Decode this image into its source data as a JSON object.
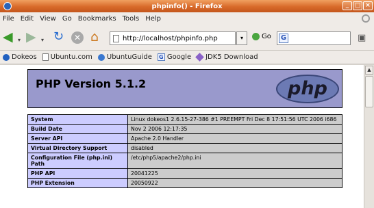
{
  "window": {
    "title": "phpinfo() - Firefox"
  },
  "menu": [
    "File",
    "Edit",
    "View",
    "Go",
    "Bookmarks",
    "Tools",
    "Help"
  ],
  "toolbar": {
    "url": "http://localhost/phpinfo.php",
    "go_label": "Go",
    "search_value": ""
  },
  "bookmarks": [
    "Dokeos",
    "Ubuntu.com",
    "UbuntuGuide",
    "Google",
    "JDK5 Download"
  ],
  "page": {
    "heading": "PHP Version 5.1.2",
    "logo_text": "php",
    "rows": [
      {
        "key": "System",
        "value": "Linux dokeos1 2.6.15-27-386 #1 PREEMPT Fri Dec 8 17:51:56 UTC 2006 i686"
      },
      {
        "key": "Build Date",
        "value": "Nov 2 2006 12:17:35"
      },
      {
        "key": "Server API",
        "value": "Apache 2.0 Handler"
      },
      {
        "key": "Virtual Directory Support",
        "value": "disabled"
      },
      {
        "key": "Configuration File (php.ini) Path",
        "value": "/etc/php5/apache2/php.ini"
      },
      {
        "key": "PHP API",
        "value": "20041225"
      },
      {
        "key": "PHP Extension",
        "value": "20050922"
      }
    ]
  },
  "colors": {
    "header_bg": "#9999cc",
    "key_bg": "#ccccff",
    "value_bg": "#cccccc",
    "titlebar": "#d86a2a"
  }
}
